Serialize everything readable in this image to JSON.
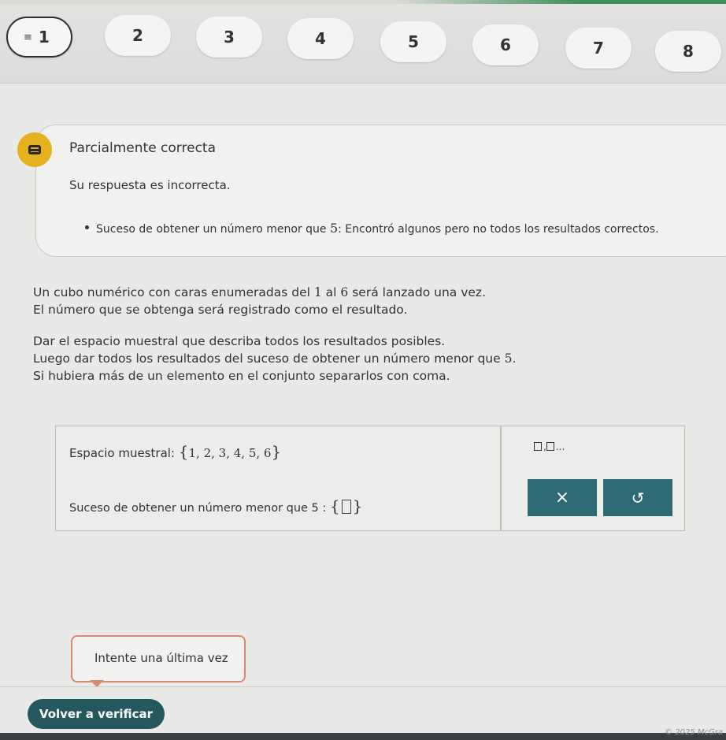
{
  "nav": {
    "questions": [
      "1",
      "2",
      "3",
      "4",
      "5",
      "6",
      "7",
      "8"
    ]
  },
  "feedback": {
    "title": "Parcialmente correcta",
    "message": "Su respuesta es incorrecta.",
    "bullet_prefix": "Suceso de obtener un número menor que ",
    "bullet_number": "5",
    "bullet_suffix": ": Encontró algunos pero no todos los resultados correctos."
  },
  "question": {
    "line1_a": "Un cubo numérico con caras enumeradas del ",
    "line1_n1": "1",
    "line1_b": " al ",
    "line1_n2": "6",
    "line1_c": " será lanzado una vez.",
    "line2": "El número que se obtenga será registrado como el resultado.",
    "line3": "Dar el espacio muestral que describa todos los resultados posibles.",
    "line4_a": "Luego dar todos los resultados del suceso de obtener un número menor que ",
    "line4_n": "5",
    "line4_b": ".",
    "line5": "Si hubiera más de un elemento en el conjunto separarlos con coma."
  },
  "answer": {
    "sample_space_label": "Espacio muestral:",
    "sample_space_value": "1, 2, 3, 4, 5, 6",
    "event_label": "Suceso de obtener un número menor que 5 :"
  },
  "tools": {
    "symbol_label": ",",
    "symbol_suffix": "...",
    "clear_label": "×",
    "undo_label": "↺"
  },
  "hint": {
    "text": "Intente una última vez"
  },
  "actions": {
    "verify_label": "Volver a verificar"
  },
  "footer": {
    "copyright": "© 2025 McGra"
  },
  "colors": {
    "teal_button": "#2c6a74",
    "verify_button": "#25585e",
    "feedback_icon": "#e5b11e",
    "tooltip_border": "#d98a6c"
  }
}
